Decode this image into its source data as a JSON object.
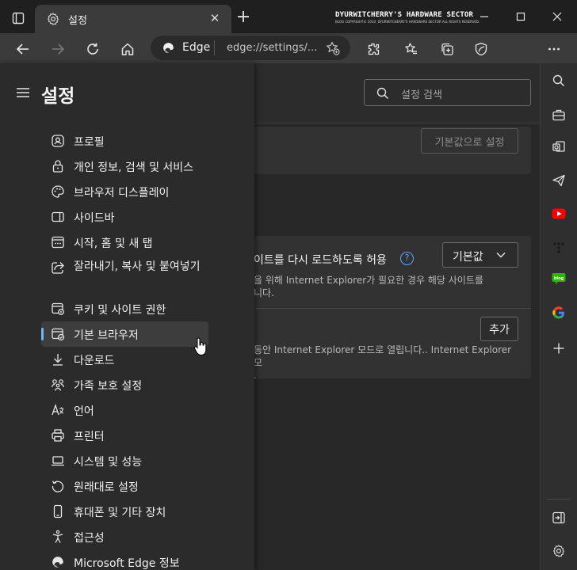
{
  "window": {
    "tab_title": "설정",
    "watermark_title": "DYURWITCHERRY'S HARDWARE SECTOR",
    "watermark_sub": "BLOG COPYRIGHT© 2010. DYURWITCHERRY'S HARDWARE SECTOR ALL RIGHTS RESERVED."
  },
  "toolbar": {
    "site_name": "Edge",
    "url": "edge://settings/..."
  },
  "settings": {
    "title": "설정",
    "search_placeholder": "설정 검색",
    "reset_button": "기본값으로 설정",
    "reload_title": "이트를 다시 로드하도록 허용",
    "reload_desc_1": "을 위해 Internet Explorer가 필요한 경우 해당 사이트를",
    "reload_desc_2": "니다.",
    "select_value": "기본값",
    "add_button": "추가",
    "ie_desc_1": "동안 Internet Explorer 모드로 열립니다.. Internet Explorer 모",
    "ie_desc_2": "."
  },
  "nav": {
    "items": [
      {
        "label": "프로필",
        "icon": "profile-icon"
      },
      {
        "label": "개인 정보, 검색 및 서비스",
        "icon": "lock-icon"
      },
      {
        "label": "브라우저 디스플레이",
        "icon": "palette-icon"
      },
      {
        "label": "사이드바",
        "icon": "sidebar-icon"
      },
      {
        "label": "시작, 홈 및 새 탭",
        "icon": "start-page-icon"
      },
      {
        "label": "잘라내기, 복사 및 붙여넣기",
        "icon": "share-icon"
      },
      {
        "label": "쿠키 및 사이트 권한",
        "icon": "site-permissions-icon"
      },
      {
        "label": "기본 브라우저",
        "icon": "default-browser-icon"
      },
      {
        "label": "다운로드",
        "icon": "download-icon"
      },
      {
        "label": "가족 보호 설정",
        "icon": "family-icon"
      },
      {
        "label": "언어",
        "icon": "language-icon"
      },
      {
        "label": "프린터",
        "icon": "printer-icon"
      },
      {
        "label": "시스템 및 성능",
        "icon": "laptop-icon"
      },
      {
        "label": "원래대로 설정",
        "icon": "reset-icon"
      },
      {
        "label": "휴대폰 및 기타 장치",
        "icon": "phone-icon"
      },
      {
        "label": "접근성",
        "icon": "accessibility-icon"
      },
      {
        "label": "Microsoft Edge 정보",
        "icon": "edge-logo-icon"
      }
    ],
    "selected_index": 7
  },
  "colors": {
    "accent": "#6cb6ff",
    "youtube": "#ff0000",
    "naver": "#2db400"
  }
}
